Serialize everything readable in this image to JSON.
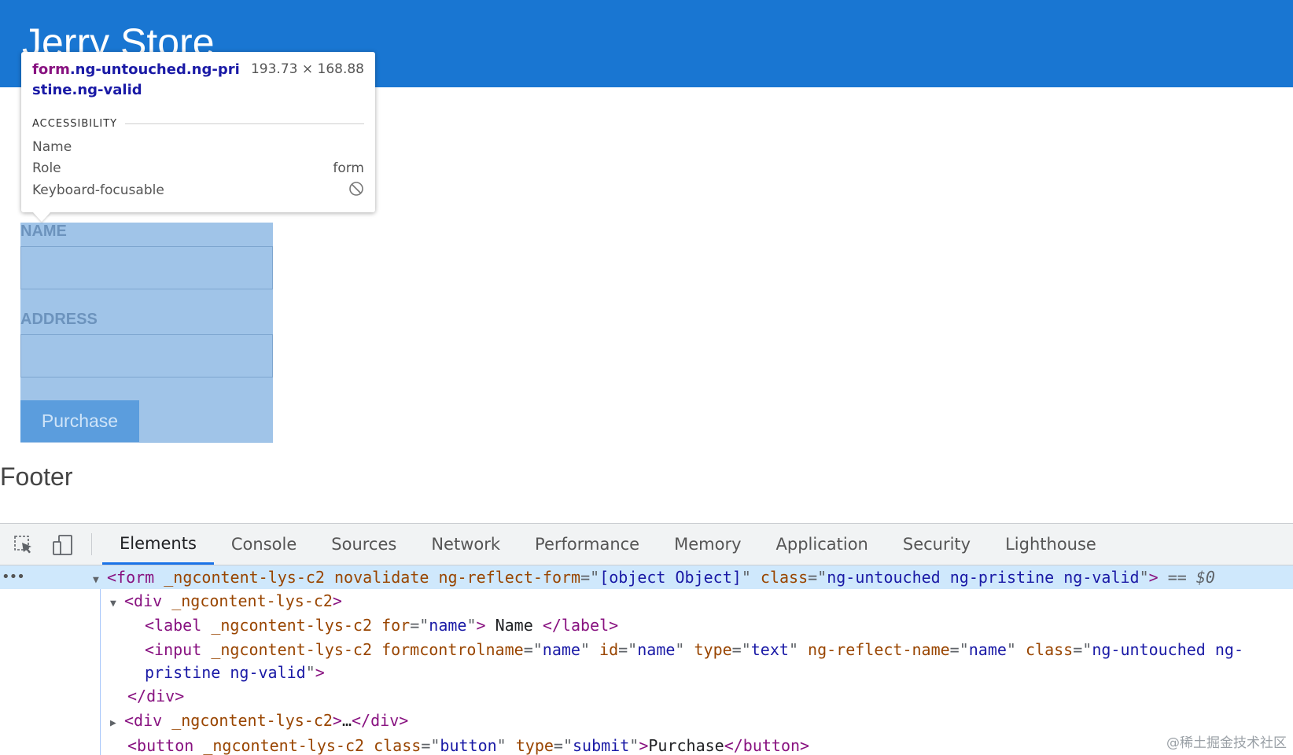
{
  "app": {
    "title": "Jerry Store",
    "header_color": "#1976d2"
  },
  "tooltip": {
    "selector_tag": "form",
    "selector_classes": ".ng-untouched.ng-pristine.ng-valid",
    "size": "193.73 × 168.88",
    "section": "ACCESSIBILITY",
    "rows": [
      {
        "label": "Name",
        "value": ""
      },
      {
        "label": "Role",
        "value": "form"
      },
      {
        "label": "Keyboard-focusable",
        "icon": "not-allowed-icon"
      }
    ]
  },
  "form": {
    "name_label": "NAME",
    "address_label": "ADDRESS",
    "purchase_label": "Purchase",
    "highlight_color": "#a0c4e8"
  },
  "footer": {
    "text": "Footer"
  },
  "devtools": {
    "tabs": [
      "Elements",
      "Console",
      "Sources",
      "Network",
      "Performance",
      "Memory",
      "Application",
      "Security",
      "Lighthouse"
    ],
    "active_tab": "Elements",
    "accent": "#1a73e8",
    "tree": {
      "form_open": {
        "tag": "form",
        "attrs_plain": "_ngcontent-lys-c2 novalidate",
        "reflect_attr": "ng-reflect-form",
        "reflect_val": "[object Object]",
        "class_attr": "class",
        "class_val": "ng-untouched ng-pristine ng-valid",
        "marker": "== $0"
      },
      "div_open": {
        "tag": "div",
        "attr": "_ngcontent-lys-c2"
      },
      "label_line": {
        "tag": "label",
        "attr": "_ngcontent-lys-c2",
        "for_attr": "for",
        "for_val": "name",
        "text": "Name"
      },
      "input_line": {
        "tag": "input",
        "attr": "_ngcontent-lys-c2",
        "a1": "formcontrolname",
        "v1": "name",
        "a2": "id",
        "v2": "name",
        "a3": "type",
        "v3": "text",
        "a4": "ng-reflect-name",
        "v4": "name",
        "a5": "class",
        "v5a": "ng-untouched ng-",
        "v5b": "pristine ng-valid"
      },
      "div_close": "div",
      "div_collapsed": {
        "tag": "div",
        "attr": "_ngcontent-lys-c2",
        "ellipsis": "…"
      },
      "button_line": {
        "tag": "button",
        "attr": "_ngcontent-lys-c2",
        "a1": "class",
        "v1": "button",
        "a2": "type",
        "v2": "submit",
        "text": "Purchase"
      }
    }
  },
  "watermark": "@稀土掘金技术社区"
}
